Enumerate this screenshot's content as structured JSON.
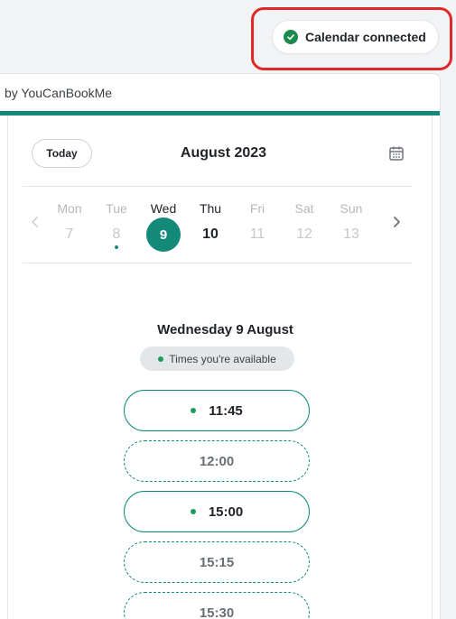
{
  "toast": {
    "label": "Calendar connected"
  },
  "card": {
    "header_text": "by YouCanBookMe"
  },
  "calendar": {
    "today_label": "Today",
    "month": "August 2023",
    "days": [
      {
        "weekday": "Mon",
        "date": "7",
        "active": false,
        "selected": false,
        "dot": false
      },
      {
        "weekday": "Tue",
        "date": "8",
        "active": false,
        "selected": false,
        "dot": true
      },
      {
        "weekday": "Wed",
        "date": "9",
        "active": true,
        "selected": true,
        "dot": false
      },
      {
        "weekday": "Thu",
        "date": "10",
        "active": true,
        "selected": false,
        "dot": false
      },
      {
        "weekday": "Fri",
        "date": "11",
        "active": false,
        "selected": false,
        "dot": false
      },
      {
        "weekday": "Sat",
        "date": "12",
        "active": false,
        "selected": false,
        "dot": false
      },
      {
        "weekday": "Sun",
        "date": "13",
        "active": false,
        "selected": false,
        "dot": false
      }
    ]
  },
  "selected_date": "Wednesday 9 August",
  "availability_label": "Times you're available",
  "slots": [
    {
      "time": "11:45",
      "available": true
    },
    {
      "time": "12:00",
      "available": false
    },
    {
      "time": "15:00",
      "available": true
    },
    {
      "time": "15:15",
      "available": false
    },
    {
      "time": "15:30",
      "available": false
    }
  ],
  "colors": {
    "accent": "#13897a",
    "success": "#1a8a4e",
    "highlight": "#e0282a"
  }
}
